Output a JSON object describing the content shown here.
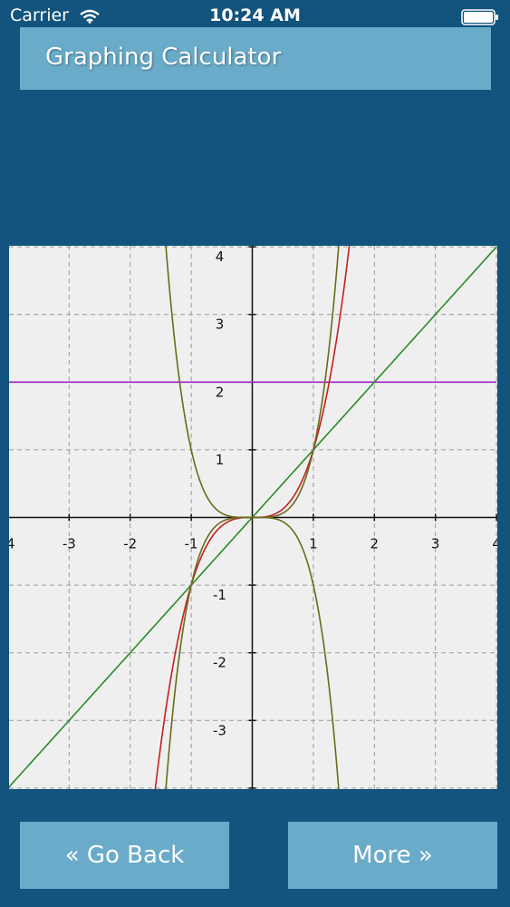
{
  "status_bar": {
    "carrier": "Carrier",
    "time": "10:24 AM",
    "wifi_icon": "wifi-icon",
    "battery_icon": "battery-icon"
  },
  "header": {
    "title": "Graphing Calculator"
  },
  "buttons": {
    "back_label": "« Go Back",
    "more_label": "More »"
  },
  "colors": {
    "background": "#12547d",
    "panel": "#69abc9",
    "graph_bg": "#efeff0",
    "grid": "#9a9a9a",
    "axis": "#111111"
  },
  "chart_data": {
    "type": "line",
    "title": "",
    "xlabel": "",
    "ylabel": "",
    "xlim": [
      -4,
      4
    ],
    "ylim": [
      -4,
      4
    ],
    "grid": true,
    "x_ticks": [
      "-4",
      "-3",
      "-2",
      "-1",
      "1",
      "2",
      "3",
      "4"
    ],
    "y_ticks": [
      "-3",
      "-2",
      "-1",
      "1",
      "2",
      "3",
      "4"
    ],
    "series": [
      {
        "expression": "y = x^3",
        "color": "#c42020",
        "function": "cube"
      },
      {
        "expression": "y = -x^4",
        "color": "#6b6a1a",
        "function": "neg_quartic"
      },
      {
        "expression": "y = x^4",
        "color": "#6b6a1a",
        "function": "quartic"
      },
      {
        "expression": "y = x",
        "color": "#2a8a2a",
        "function": "identity"
      },
      {
        "expression": "y = 2",
        "color": "#a020c0",
        "function": "const2"
      }
    ]
  }
}
